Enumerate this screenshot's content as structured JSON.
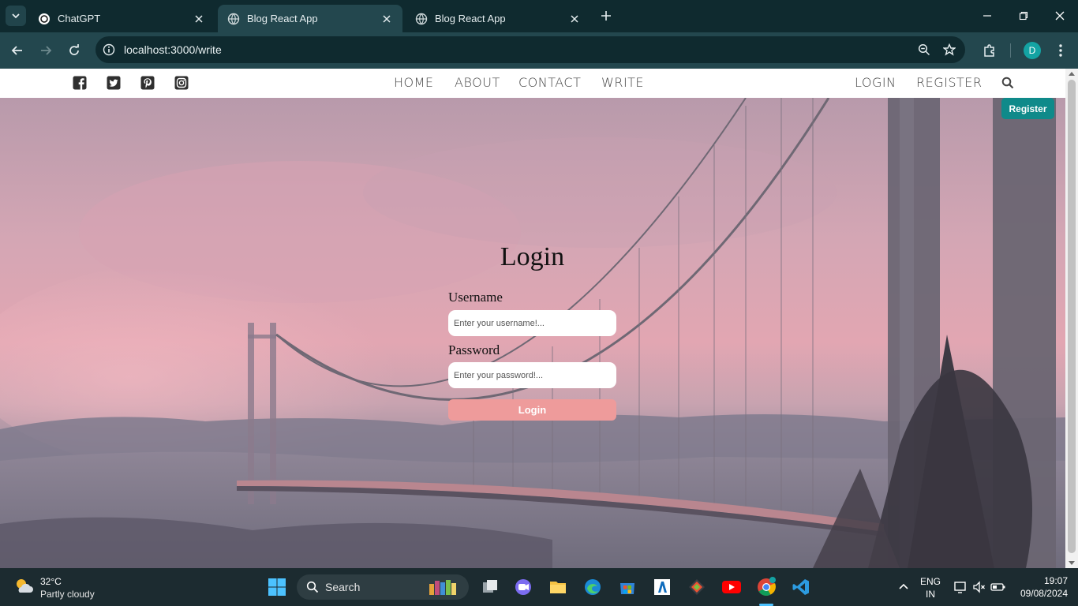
{
  "browser": {
    "tabs": [
      {
        "title": "ChatGPT",
        "active": false
      },
      {
        "title": "Blog React App",
        "active": true
      },
      {
        "title": "Blog React App",
        "active": false
      }
    ],
    "url": "localhost:3000/write",
    "profile_initial": "D"
  },
  "topnav": {
    "social_icons": [
      "facebook-icon",
      "twitter-icon",
      "pinterest-icon",
      "instagram-icon"
    ],
    "menu": [
      "HOME",
      "ABOUT",
      "CONTACT",
      "WRITE"
    ],
    "auth": [
      "LOGIN",
      "REGISTER"
    ]
  },
  "page": {
    "register_button": "Register",
    "login": {
      "title": "Login",
      "username_label": "Username",
      "username_placeholder": "Enter your username!...",
      "password_label": "Password",
      "password_placeholder": "Enter your password!...",
      "submit_label": "Login"
    }
  },
  "taskbar": {
    "weather": {
      "temp": "32°C",
      "desc": "Partly cloudy"
    },
    "search_label": "Search",
    "language": {
      "line1": "ENG",
      "line2": "IN"
    },
    "clock": {
      "time": "19:07",
      "date": "09/08/2024"
    }
  },
  "colors": {
    "register_button": "#0f8a8a",
    "login_button": "#ee9b9b",
    "chrome_dark": "#0f2a2f",
    "chrome_toolbar": "#23474e"
  }
}
